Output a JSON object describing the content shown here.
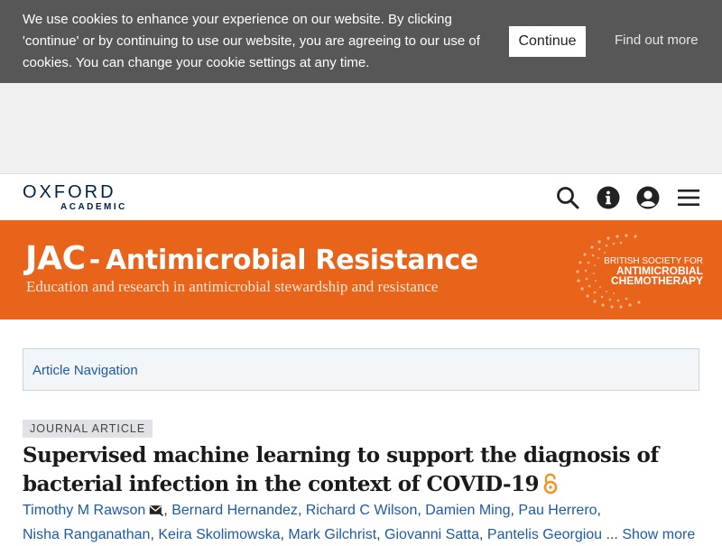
{
  "cookie_banner": {
    "text": "We use cookies to enhance your experience on our website. By clicking 'continue' or by continuing to use our website, you are agreeing to our use of cookies. You can change your cookie settings at any time.",
    "continue_label": "Continue",
    "find_out_more_label": "Find out more"
  },
  "header": {
    "logo_main": "OXFORD",
    "logo_sub": "ACADEMIC",
    "icons": [
      "search-icon",
      "info-icon",
      "user-icon",
      "menu-icon"
    ]
  },
  "journal": {
    "title_prefix": "JAC",
    "title_sep": "-",
    "title_main": "Antimicrobial Resistance",
    "subtitle": "Education and research in antimicrobial stewardship and resistance",
    "society_line1": "BRITISH SOCIETY FOR",
    "society_line2": "ANTIMICROBIAL",
    "society_line3": "CHEMOTHERAPY"
  },
  "article_nav": {
    "label": "Article Navigation"
  },
  "article": {
    "type": "JOURNAL ARTICLE",
    "title": "Supervised machine learning to support the diagnosis of bacterial infection in the context of COVID-19",
    "authors": [
      "Timothy M Rawson",
      "Bernard Hernandez",
      "Richard C Wilson",
      "Damien Ming",
      "Pau Herrero",
      "Nisha Ranganathan",
      "Keira Skolimowska",
      "Mark Gilchrist",
      "Giovanni Satta",
      "Pantelis Georgiou"
    ],
    "ellipsis": "...",
    "show_more": "Show more"
  },
  "colors": {
    "cookie_bg": "#575757",
    "banner_orange": "#e8641b",
    "link_blue": "#1d5aa6",
    "oxford_navy": "#002147",
    "open_access_orange": "#f7931e"
  }
}
